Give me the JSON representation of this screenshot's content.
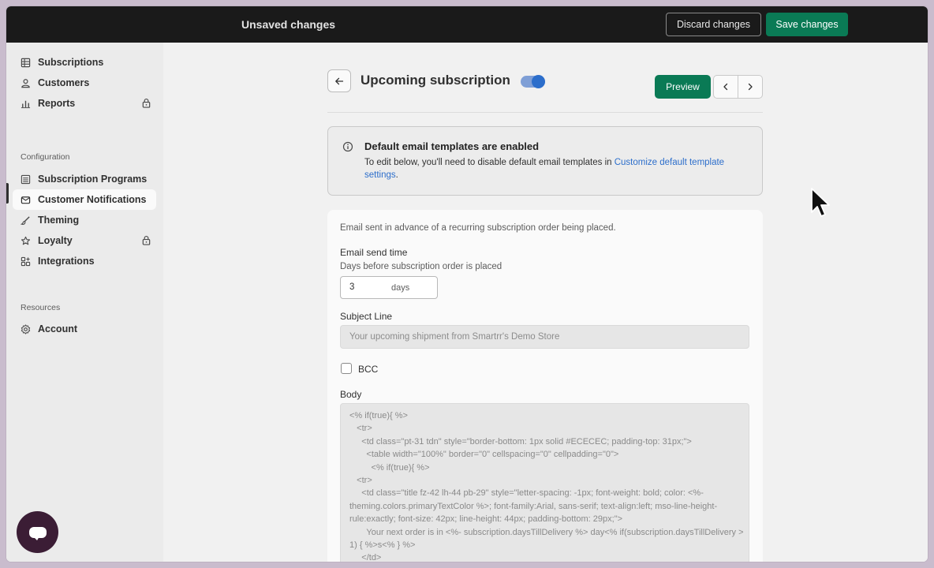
{
  "topbar": {
    "title": "Unsaved changes",
    "discard_label": "Discard changes",
    "save_label": "Save changes",
    "save_color": "#0a7a55"
  },
  "sidebar": {
    "items": [
      {
        "label": "Subscriptions",
        "icon": "grid-icon"
      },
      {
        "label": "Customers",
        "icon": "person-icon"
      },
      {
        "label": "Reports",
        "icon": "bar-chart-icon",
        "locked": true
      }
    ],
    "configuration_label": "Configuration",
    "config_items": [
      {
        "label": "Subscription Programs",
        "icon": "list-icon"
      },
      {
        "label": "Customer Notifications",
        "icon": "mail-icon",
        "active": true
      },
      {
        "label": "Theming",
        "icon": "brush-icon"
      },
      {
        "label": "Loyalty",
        "icon": "star-icon",
        "locked": true
      },
      {
        "label": "Integrations",
        "icon": "apps-icon"
      }
    ],
    "resources_label": "Resources",
    "resource_items": [
      {
        "label": "Account",
        "icon": "gear-icon"
      }
    ]
  },
  "header": {
    "title": "Upcoming subscription",
    "toggle_on": true,
    "preview_label": "Preview"
  },
  "banner": {
    "title": "Default email templates are enabled",
    "text": "To edit below, you'll need to disable default email templates in ",
    "link": "Customize default template settings",
    "suffix": "."
  },
  "form": {
    "description": "Email sent in advance of a recurring subscription order being placed.",
    "send_time_label": "Email send time",
    "send_time_help": "Days before subscription order is placed",
    "days_value": "3",
    "days_unit": "days",
    "subject_label": "Subject Line",
    "subject_placeholder": "Your upcoming shipment from Smartrr's Demo Store",
    "bcc_label": "BCC",
    "bcc_checked": false,
    "body_label": "Body",
    "body_code": "<% if(true){ %>\n   <tr>\n     <td class=\"pt-31 tdn\" style=\"border-bottom: 1px solid #ECECEC; padding-top: 31px;\">\n       <table width=\"100%\" border=\"0\" cellspacing=\"0\" cellpadding=\"0\">\n         <% if(true){ %>\n   <tr>\n     <td class=\"title fz-42 lh-44 pb-29\" style=\"letter-spacing: -1px; font-weight: bold; color: <%- theming.colors.primaryTextColor %>; font-family:Arial, sans-serif; text-align:left; mso-line-height-rule:exactly; font-size: 42px; line-height: 44px; padding-bottom: 29px;\">\n       Your next order is in <%- subscription.daysTillDelivery %> day<% if(subscription.daysTillDelivery > 1) { %>s<% } %>\n     </td>\n   </tr>"
  }
}
